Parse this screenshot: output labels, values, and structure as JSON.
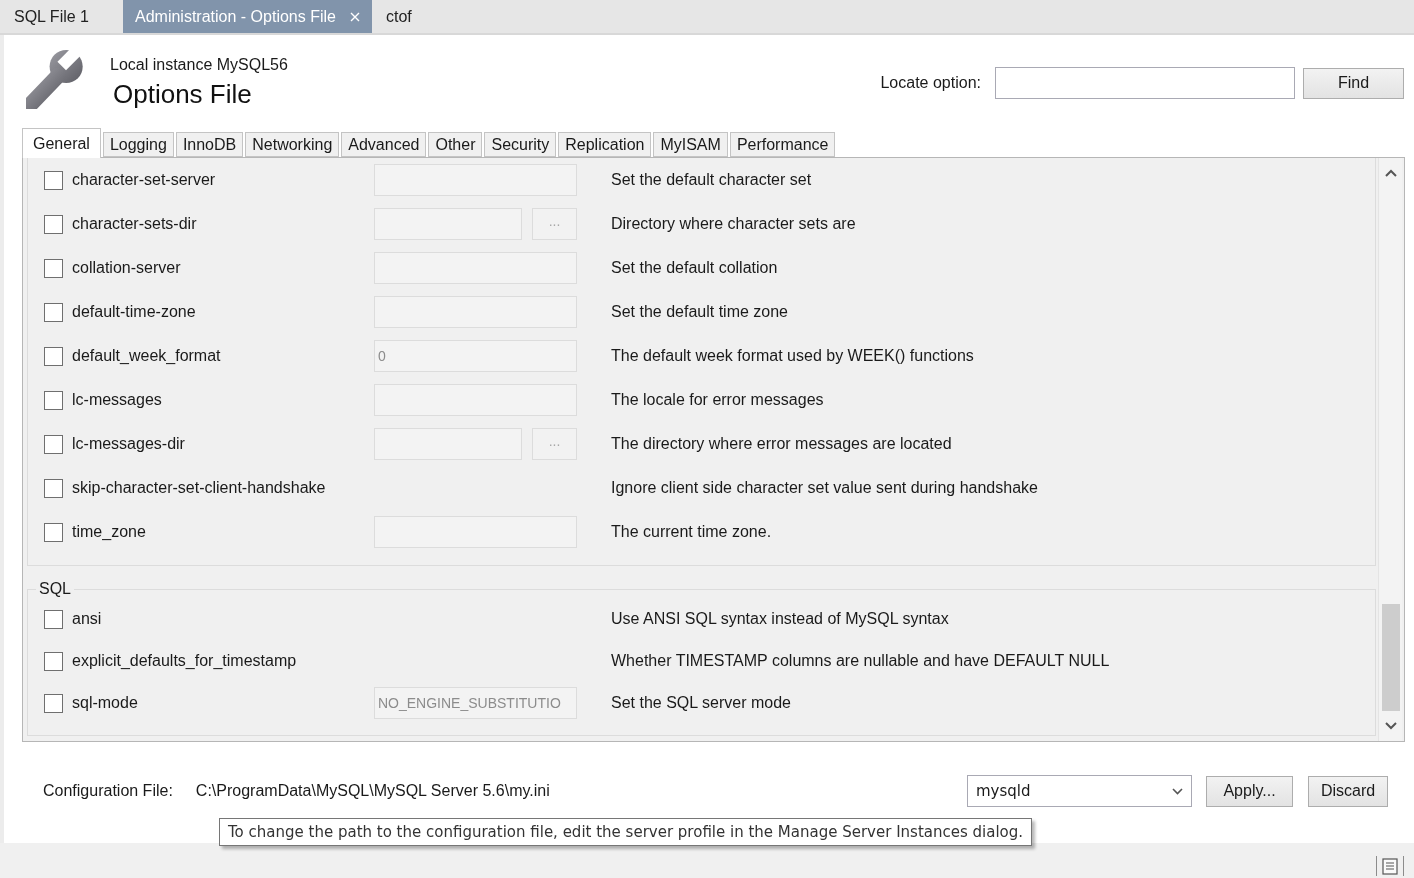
{
  "editor_tabs": [
    {
      "label": "SQL File 1",
      "selected": false,
      "closable": false
    },
    {
      "label": "Administration - Options File",
      "selected": true,
      "closable": true
    },
    {
      "label": "ctof",
      "selected": false,
      "closable": false
    }
  ],
  "header": {
    "subtitle": "Local instance MySQL56",
    "title": "Options File"
  },
  "locate": {
    "label": "Locate option:",
    "button": "Find"
  },
  "option_tabs": [
    {
      "label": "General",
      "selected": true
    },
    {
      "label": "Logging",
      "selected": false
    },
    {
      "label": "InnoDB",
      "selected": false
    },
    {
      "label": "Networking",
      "selected": false
    },
    {
      "label": "Advanced",
      "selected": false
    },
    {
      "label": "Other",
      "selected": false
    },
    {
      "label": "Security",
      "selected": false
    },
    {
      "label": "Replication",
      "selected": false
    },
    {
      "label": "MyISAM",
      "selected": false
    },
    {
      "label": "Performance",
      "selected": false
    }
  ],
  "groups": [
    {
      "options": [
        {
          "kind": "text",
          "name": "character-set-server",
          "checked": false,
          "description": "Set the default character set"
        },
        {
          "kind": "path",
          "name": "character-sets-dir",
          "checked": false,
          "browse": "...",
          "description": "Directory where character sets are"
        },
        {
          "kind": "text",
          "name": "collation-server",
          "checked": false,
          "description": "Set the default collation"
        },
        {
          "kind": "text",
          "name": "default-time-zone",
          "checked": false,
          "description": "Set the default time zone"
        },
        {
          "kind": "text",
          "name": "default_week_format",
          "checked": false,
          "value": "0",
          "description": "The default week format used by WEEK() functions"
        },
        {
          "kind": "text",
          "name": "lc-messages",
          "checked": false,
          "description": "The locale for error messages"
        },
        {
          "kind": "path",
          "name": "lc-messages-dir",
          "checked": false,
          "browse": "...",
          "description": "The directory where error messages are located"
        },
        {
          "kind": "flag",
          "name": "skip-character-set-client-handshake",
          "checked": false,
          "description": "Ignore client side character set value sent during handshake"
        },
        {
          "kind": "text",
          "name": "time_zone",
          "checked": false,
          "description": "The current time zone."
        }
      ]
    },
    {
      "title": "SQL",
      "options": [
        {
          "kind": "flag",
          "name": "ansi",
          "checked": false,
          "description": "Use ANSI SQL syntax instead of MySQL syntax"
        },
        {
          "kind": "flag",
          "name": "explicit_defaults_for_timestamp",
          "checked": false,
          "description": "Whether TIMESTAMP columns are nullable and have DEFAULT NULL"
        },
        {
          "kind": "text",
          "name": "sql-mode",
          "checked": false,
          "value": "NO_ENGINE_SUBSTITUTIO",
          "description": "Set the SQL server mode"
        }
      ]
    }
  ],
  "config": {
    "label": "Configuration File:",
    "path": "C:\\ProgramData\\MySQL\\MySQL Server 5.6\\my.ini",
    "section": "mysqld",
    "apply": "Apply...",
    "discard": "Discard"
  },
  "tooltip": "To change the path to the configuration file, edit the server profile in the Manage Server Instances dialog."
}
